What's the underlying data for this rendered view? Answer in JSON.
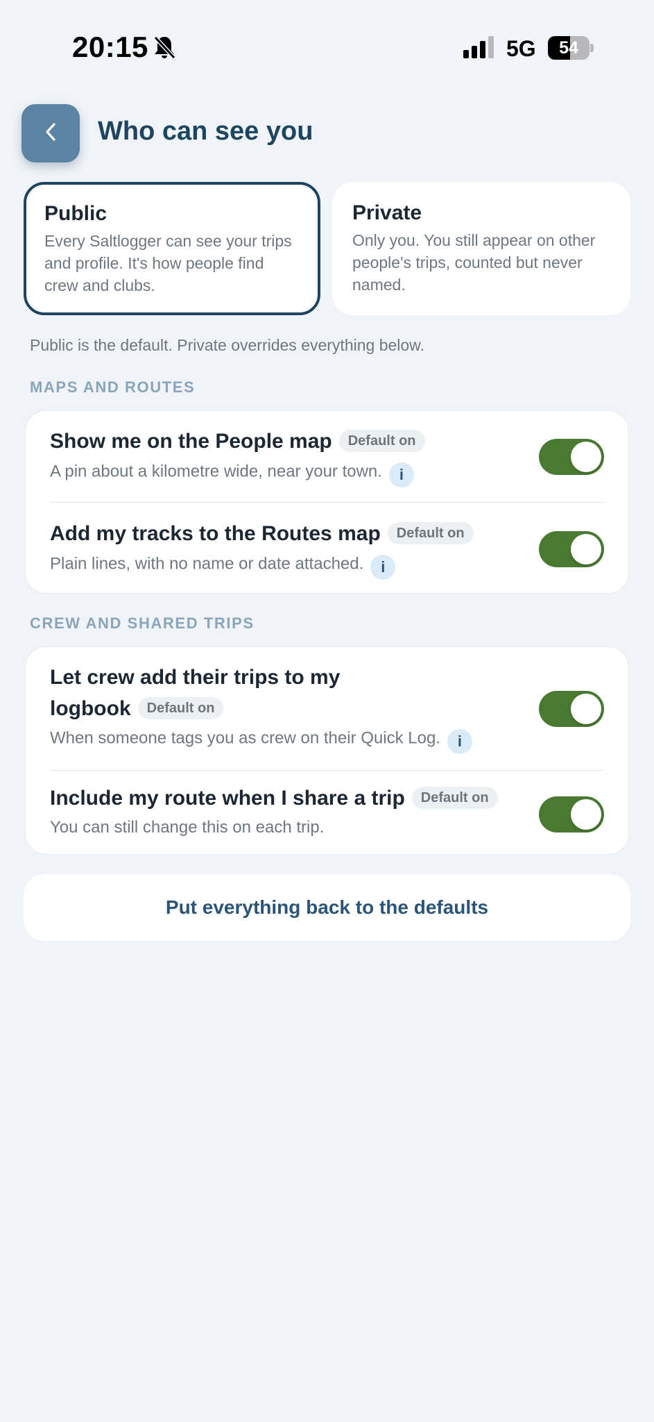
{
  "status_bar": {
    "time": "20:15",
    "network": "5G",
    "battery_percent": 54,
    "battery_text": "54",
    "icons": [
      "bell-slash-icon",
      "signal-icon",
      "battery-icon"
    ]
  },
  "header": {
    "back_icon": "chevron-left-icon",
    "title": "Who can see you"
  },
  "visibility": {
    "options": [
      {
        "title": "Public",
        "description": "Every Saltlogger can see your trips and profile. It's how people find crew and clubs.",
        "selected": true
      },
      {
        "title": "Private",
        "description": "Only you. You still appear on other people's trips, counted but never named.",
        "selected": false
      }
    ],
    "note": "Public is the default. Private overrides everything below."
  },
  "sections": [
    {
      "label": "MAPS AND ROUTES",
      "items": [
        {
          "title": "Show me on the People map",
          "badge": "Default on",
          "description": "A pin about a kilometre wide, near your town.",
          "info_icon": "i",
          "enabled": true
        },
        {
          "title": "Add my tracks to the Routes map",
          "badge": "Default on",
          "description": "Plain lines, with no name or date attached.",
          "info_icon": "i",
          "enabled": true
        }
      ]
    },
    {
      "label": "CREW AND SHARED TRIPS",
      "items": [
        {
          "title_line1": "Let crew add their trips to my",
          "title_line2": "logbook",
          "badge": "Default on",
          "description": "When someone tags you as crew on their Quick Log.",
          "info_icon": "i",
          "enabled": true
        },
        {
          "title": "Include my route when I share a trip",
          "badge": "Default on",
          "description": "You can still change this on each trip.",
          "enabled": true
        }
      ]
    }
  ],
  "reset_label": "Put everything back to the defaults",
  "colors": {
    "background": "#f0f4f8",
    "accent": "#1e4560",
    "toggle_on": "#4a7a32",
    "back_button": "#5d83a3",
    "section_label": "#8aa4ba"
  }
}
